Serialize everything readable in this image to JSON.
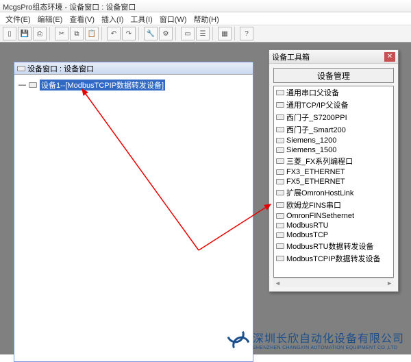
{
  "title": "McgsPro组态环境 - 设备窗口 : 设备窗口",
  "menu": [
    "文件(E)",
    "编辑(E)",
    "查看(V)",
    "插入(I)",
    "工具(I)",
    "窗口(W)",
    "帮助(H)"
  ],
  "childWindow": {
    "title": "设备窗口 : 设备窗口",
    "treeItem": "设备1--[ModbusTCPIP数据转发设备]"
  },
  "toolbox": {
    "title": "设备工具箱",
    "button": "设备管理",
    "items": [
      "通用串口父设备",
      "通用TCP/IP父设备",
      "西门子_S7200PPI",
      "西门子_Smart200",
      "Siemens_1200",
      "Siemens_1500",
      "三菱_FX系列编程口",
      "FX3_ETHERNET",
      "FX5_ETHERNET",
      "扩展OmronHostLink",
      "欧姆龙FINS串口",
      "OmronFINSethernet",
      "ModbusRTU",
      "ModbusTCP",
      "ModbusRTU数据转发设备",
      "ModbusTCPIP数据转发设备"
    ]
  },
  "watermark": {
    "cn": "深圳长欣自动化设备有限公司",
    "en": "SHENZHEN CHANGXIN AUTOMATION EQUIPMENT CO.,LTD"
  }
}
